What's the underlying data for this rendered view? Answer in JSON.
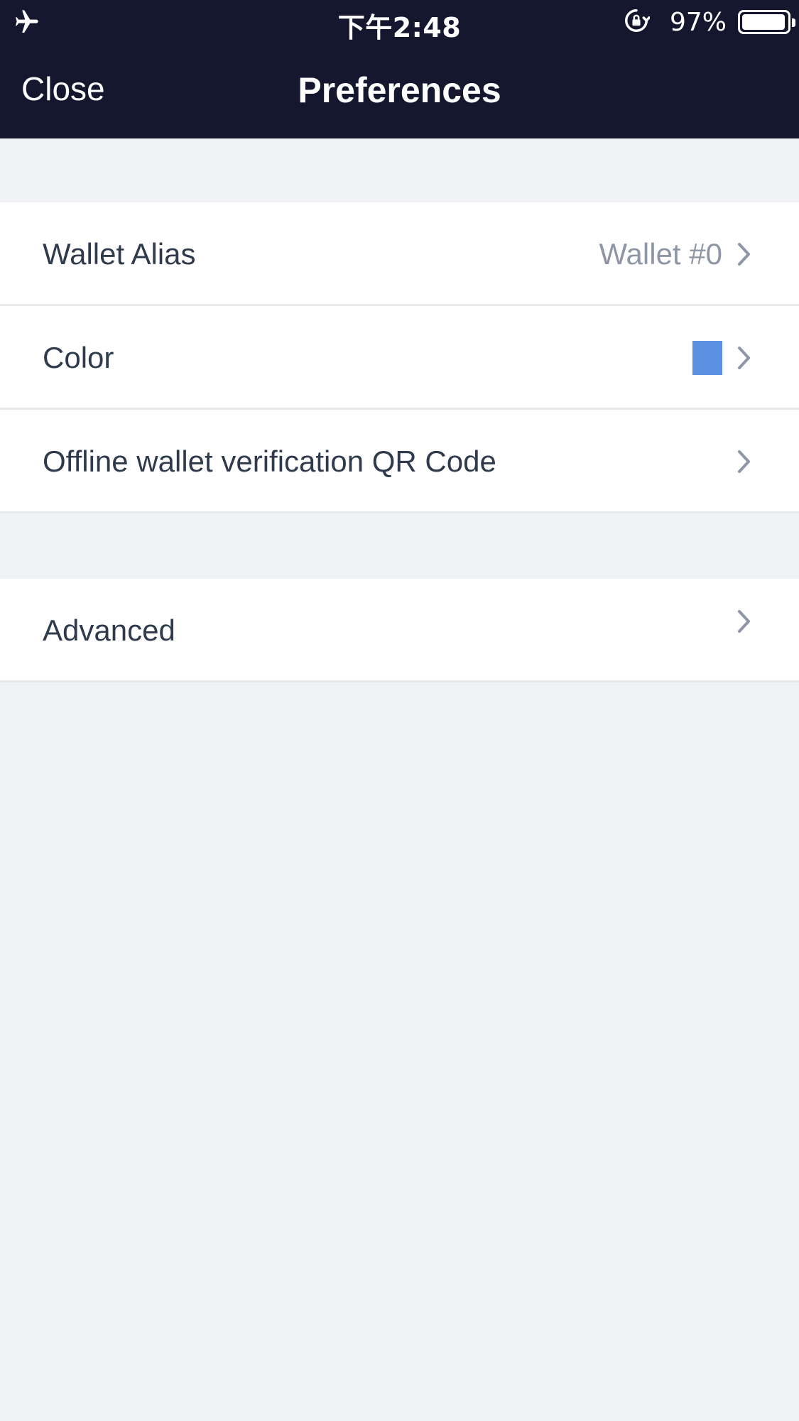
{
  "status_bar": {
    "time": "下午2:48",
    "battery_percent_label": "97%",
    "battery_level": 0.97,
    "icons": [
      "airplane-icon",
      "orientation-lock-icon",
      "battery-icon"
    ]
  },
  "nav": {
    "close_label": "Close",
    "title": "Preferences"
  },
  "preferences": {
    "wallet_alias": {
      "label": "Wallet Alias",
      "value": "Wallet #0"
    },
    "color": {
      "label": "Color",
      "swatch": "#5b8fe0"
    },
    "offline_qr": {
      "label": "Offline wallet verification QR Code"
    },
    "advanced": {
      "label": "Advanced"
    }
  },
  "colors": {
    "header_bg": "#14172e",
    "page_bg": "#f1f2f5",
    "text_primary": "#2f3b4d",
    "text_secondary": "#8e96a6",
    "chevron": "#8e96a6"
  }
}
